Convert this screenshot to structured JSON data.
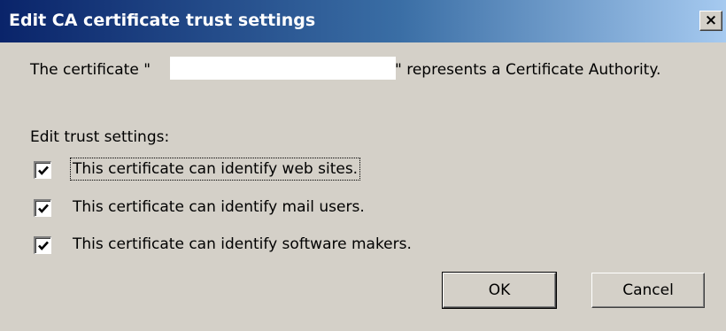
{
  "window": {
    "title": "Edit CA certificate trust settings",
    "close_label": "×"
  },
  "message": {
    "prefix": "The certificate \"",
    "suffix": "\" represents a Certificate Authority."
  },
  "trust": {
    "label": "Edit trust settings:",
    "options": [
      {
        "label": "This certificate can identify web sites.",
        "checked": true
      },
      {
        "label": "This certificate can identify mail users.",
        "checked": true
      },
      {
        "label": "This certificate can identify software makers.",
        "checked": true
      }
    ]
  },
  "buttons": {
    "ok": "OK",
    "cancel": "Cancel"
  },
  "colors": {
    "dialog_bg": "#d4d0c8",
    "titlebar_start": "#0a246a",
    "titlebar_end": "#a6caf0"
  }
}
